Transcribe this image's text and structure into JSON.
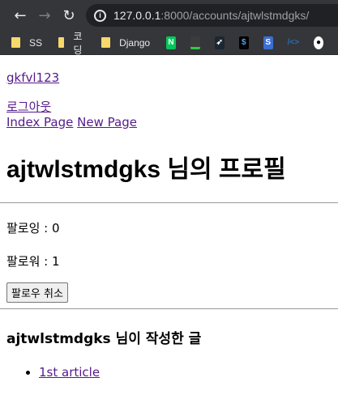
{
  "browser": {
    "url_host": "127.0.0.1",
    "url_path": ":8000/accounts/ajtwlstmdgks/",
    "bookmarks": [
      {
        "label": "SS"
      },
      {
        "label": "코딩"
      },
      {
        "label": "Django"
      }
    ],
    "favicons": [
      "naver-icon",
      "terminal-icon",
      "bird-icon",
      "dollar-terminal-icon",
      "s-icon",
      "code-icon",
      "github-icon"
    ]
  },
  "page": {
    "username_link": "gkfvl123",
    "logout_link": "로그아웃",
    "index_link": "Index Page",
    "new_link": "New Page",
    "title": "ajtwlstmdgks 님의 프로필",
    "following": "팔로잉 : 0",
    "followers": "팔로워 : 1",
    "unfollow_button": "팔로우 취소",
    "articles_heading": "ajtwlstmdgks 님이 작성한 글",
    "articles": [
      {
        "title": "1st article"
      }
    ]
  }
}
